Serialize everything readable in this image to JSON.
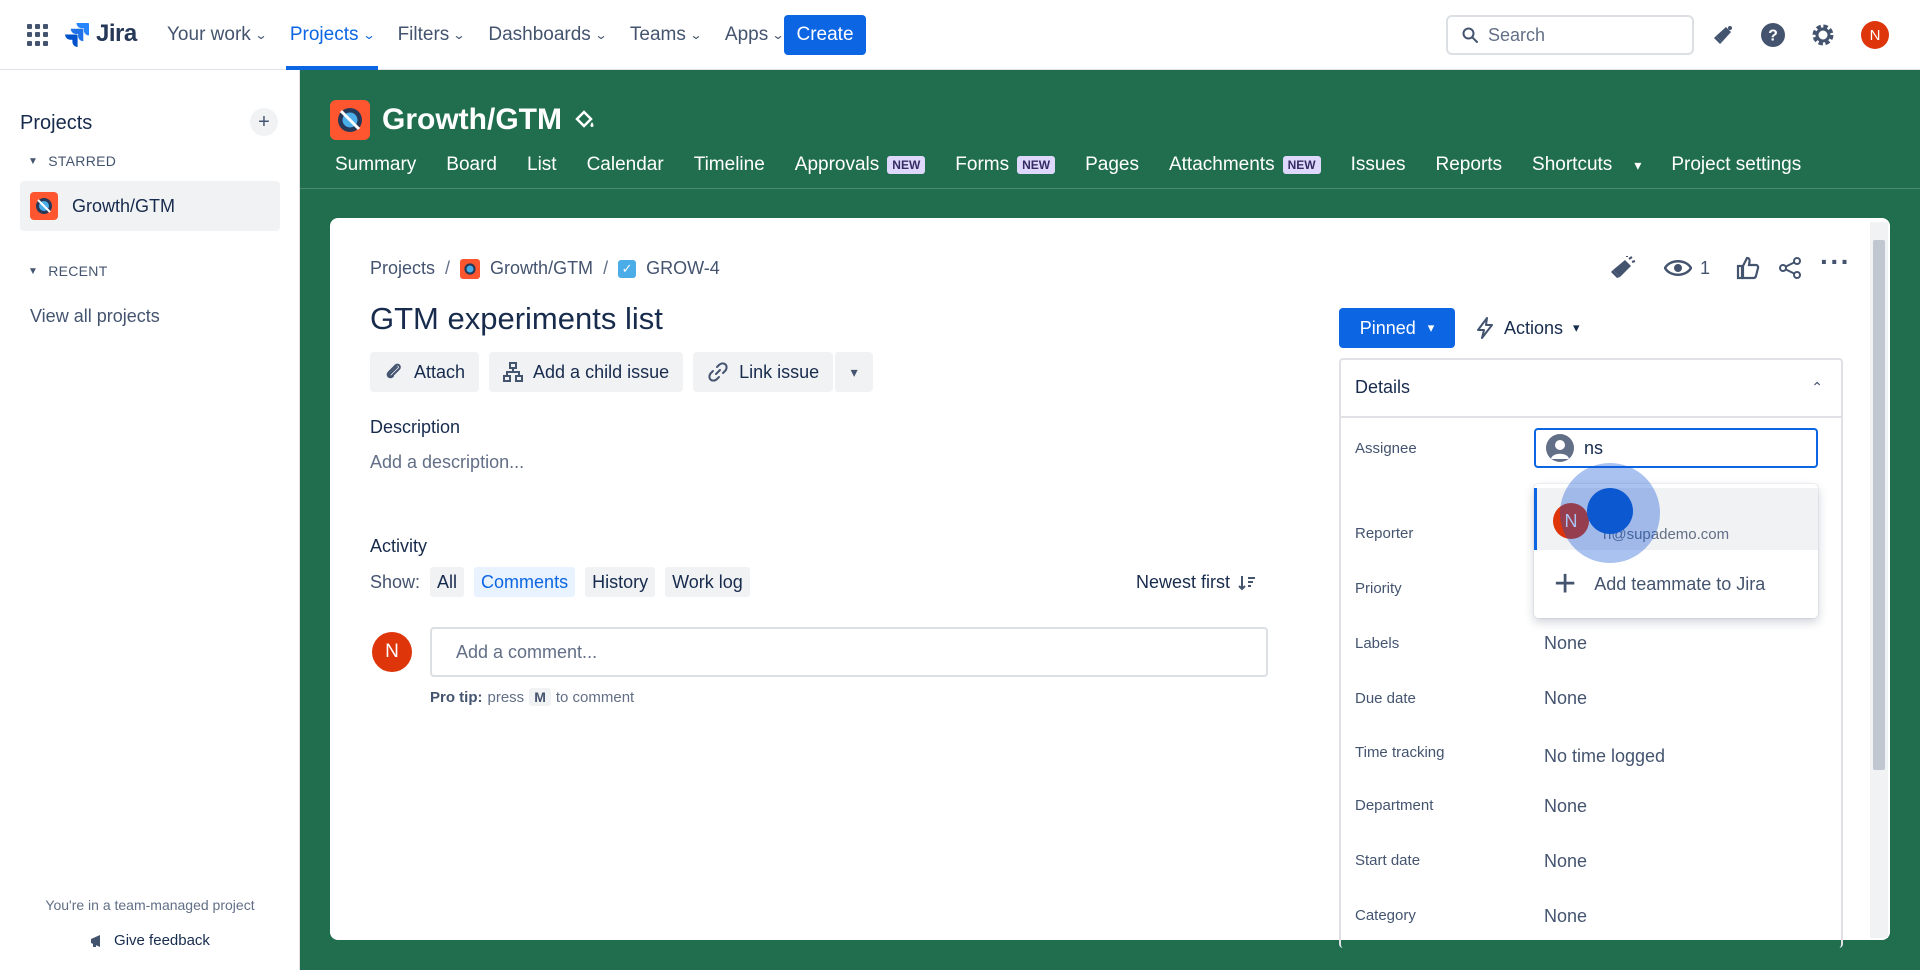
{
  "topnav": {
    "logo": "Jira",
    "items": [
      {
        "label": "Your work"
      },
      {
        "label": "Projects"
      },
      {
        "label": "Filters"
      },
      {
        "label": "Dashboards"
      },
      {
        "label": "Teams"
      },
      {
        "label": "Apps"
      }
    ],
    "active_item": "Projects",
    "create_label": "Create",
    "search_placeholder": "Search",
    "avatar_initial": "N"
  },
  "sidebar": {
    "title": "Projects",
    "starred_label": "STARRED",
    "starred_project": "Growth/GTM",
    "recent_label": "RECENT",
    "view_all": "View all projects",
    "footer_note": "You're in a team-managed project",
    "feedback": "Give feedback"
  },
  "project": {
    "name": "Growth/GTM",
    "tabs": [
      {
        "label": "Summary",
        "badge": ""
      },
      {
        "label": "Board",
        "badge": ""
      },
      {
        "label": "List",
        "badge": ""
      },
      {
        "label": "Calendar",
        "badge": ""
      },
      {
        "label": "Timeline",
        "badge": ""
      },
      {
        "label": "Approvals",
        "badge": "NEW"
      },
      {
        "label": "Forms",
        "badge": "NEW"
      },
      {
        "label": "Pages",
        "badge": ""
      },
      {
        "label": "Attachments",
        "badge": "NEW"
      },
      {
        "label": "Issues",
        "badge": ""
      },
      {
        "label": "Reports",
        "badge": ""
      },
      {
        "label": "Shortcuts",
        "badge": ""
      },
      {
        "label": "Project settings",
        "badge": ""
      }
    ]
  },
  "issue": {
    "breadcrumb": [
      "Projects",
      "Growth/GTM",
      "GROW-4"
    ],
    "title": "GTM experiments list",
    "actions": {
      "attach": "Attach",
      "child": "Add a child issue",
      "link": "Link issue"
    },
    "description_label": "Description",
    "description_placeholder": "Add a description...",
    "activity_label": "Activity",
    "show_label": "Show:",
    "filters": [
      "All",
      "Comments",
      "History",
      "Work log"
    ],
    "selected_filter": "Comments",
    "sort_label": "Newest first",
    "comment_avatar": "N",
    "comment_placeholder": "Add a comment...",
    "protip_bold": "Pro tip:",
    "protip_press": "press",
    "protip_key": "M",
    "protip_rest": "to comment",
    "watchers": "1",
    "pinned_label": "Pinned",
    "actions_label": "Actions"
  },
  "details": {
    "header": "Details",
    "assignee_label": "Assignee",
    "assignee_input": "ns",
    "dropdown": {
      "avatar": "N",
      "email": "n@supademo.com",
      "add_teammate": "Add teammate to Jira"
    },
    "fields": [
      {
        "label": "Reporter",
        "value": ""
      },
      {
        "label": "Priority",
        "value": ""
      },
      {
        "label": "Labels",
        "value": "None"
      },
      {
        "label": "Due date",
        "value": "None"
      },
      {
        "label": "Time tracking",
        "value": "No time logged"
      },
      {
        "label": "Department",
        "value": "None"
      },
      {
        "label": "Start date",
        "value": "None"
      },
      {
        "label": "Category",
        "value": "None"
      }
    ]
  },
  "colors": {
    "brand_blue": "#0c66e4",
    "project_green": "#216e4e",
    "avatar_red": "#de350b",
    "project_icon": "#ff5630"
  }
}
